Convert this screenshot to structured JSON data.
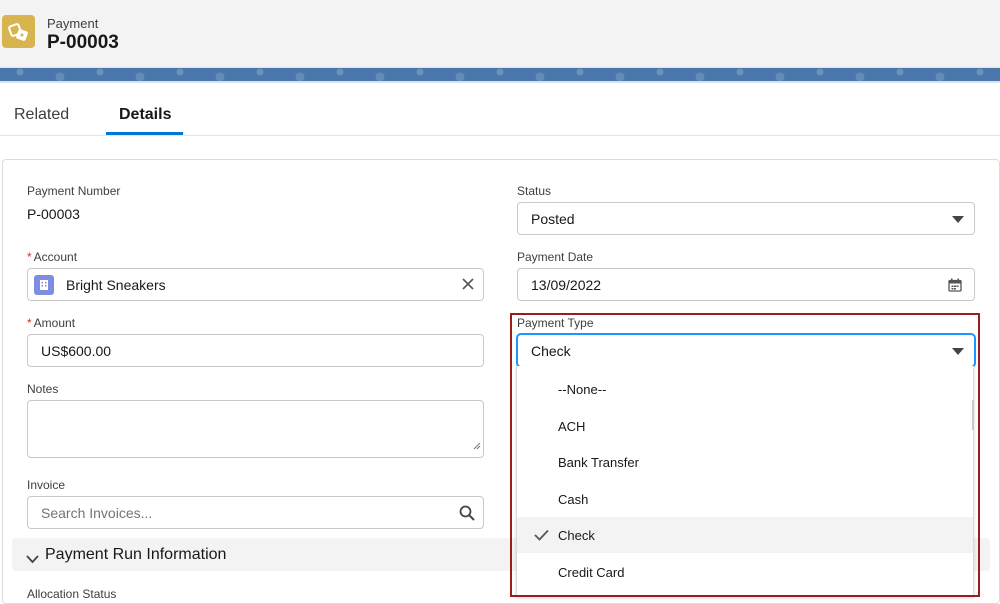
{
  "header": {
    "object_label": "Payment",
    "record_title": "P-00003",
    "icon": "payment-icon"
  },
  "tabs": [
    {
      "label": "Related",
      "active": false
    },
    {
      "label": "Details",
      "active": true
    }
  ],
  "form": {
    "payment_number": {
      "label": "Payment Number",
      "value": "P-00003"
    },
    "status": {
      "label": "Status",
      "value": "Posted"
    },
    "account": {
      "label": "Account",
      "required_mark": "*",
      "value": "Bright Sneakers",
      "icon": "account-icon"
    },
    "payment_date": {
      "label": "Payment Date",
      "value": "13/09/2022",
      "icon": "calendar-icon"
    },
    "amount": {
      "label": "Amount",
      "required_mark": "*",
      "value": "US$600.00"
    },
    "payment_type": {
      "label": "Payment Type",
      "value": "Check"
    },
    "notes": {
      "label": "Notes",
      "value": ""
    },
    "invoice": {
      "label": "Invoice",
      "placeholder": "Search Invoices...",
      "icon": "search-icon"
    }
  },
  "section": {
    "title": "Payment Run Information"
  },
  "allocation": {
    "label": "Allocation Status"
  },
  "payment_type_options": [
    {
      "label": "--None--",
      "selected": false
    },
    {
      "label": "ACH",
      "selected": false
    },
    {
      "label": "Bank Transfer",
      "selected": false
    },
    {
      "label": "Cash",
      "selected": false
    },
    {
      "label": "Check",
      "selected": true
    },
    {
      "label": "Credit Card",
      "selected": false
    }
  ],
  "colors": {
    "accent": "#0176d3",
    "brand_band": "#4a77ab",
    "object_icon": "#d8b44f",
    "required": "#c23934",
    "highlight": "#9c1c1c"
  }
}
